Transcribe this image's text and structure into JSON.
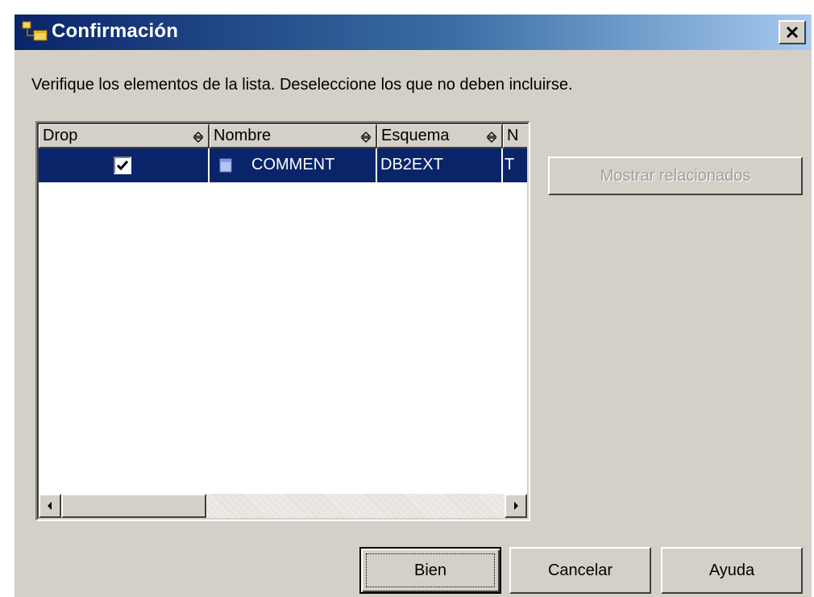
{
  "window": {
    "title": "Confirmación",
    "close_label": "×"
  },
  "instruction": "Verifique los elementos de la lista. Deseleccione los que no deben incluirse.",
  "table": {
    "columns": [
      {
        "label": "Drop"
      },
      {
        "label": "Nombre"
      },
      {
        "label": "Esquema"
      },
      {
        "label": "N"
      }
    ],
    "rows": [
      {
        "drop_checked": true,
        "nombre": "COMMENT",
        "esquema": "DB2EXT",
        "extra": "T",
        "selected": true
      }
    ]
  },
  "buttons": {
    "show_related": "Mostrar relacionados",
    "ok": "Bien",
    "cancel": "Cancelar",
    "help": "Ayuda"
  },
  "colors": {
    "titlebar_start": "#0a246a",
    "titlebar_end": "#a6caf0",
    "dialog_bg": "#d4d0c8",
    "selection_bg": "#0a246a"
  },
  "icons": {
    "title": "db-tables-icon",
    "row": "table-icon",
    "sort": "sort-updown-icon"
  }
}
